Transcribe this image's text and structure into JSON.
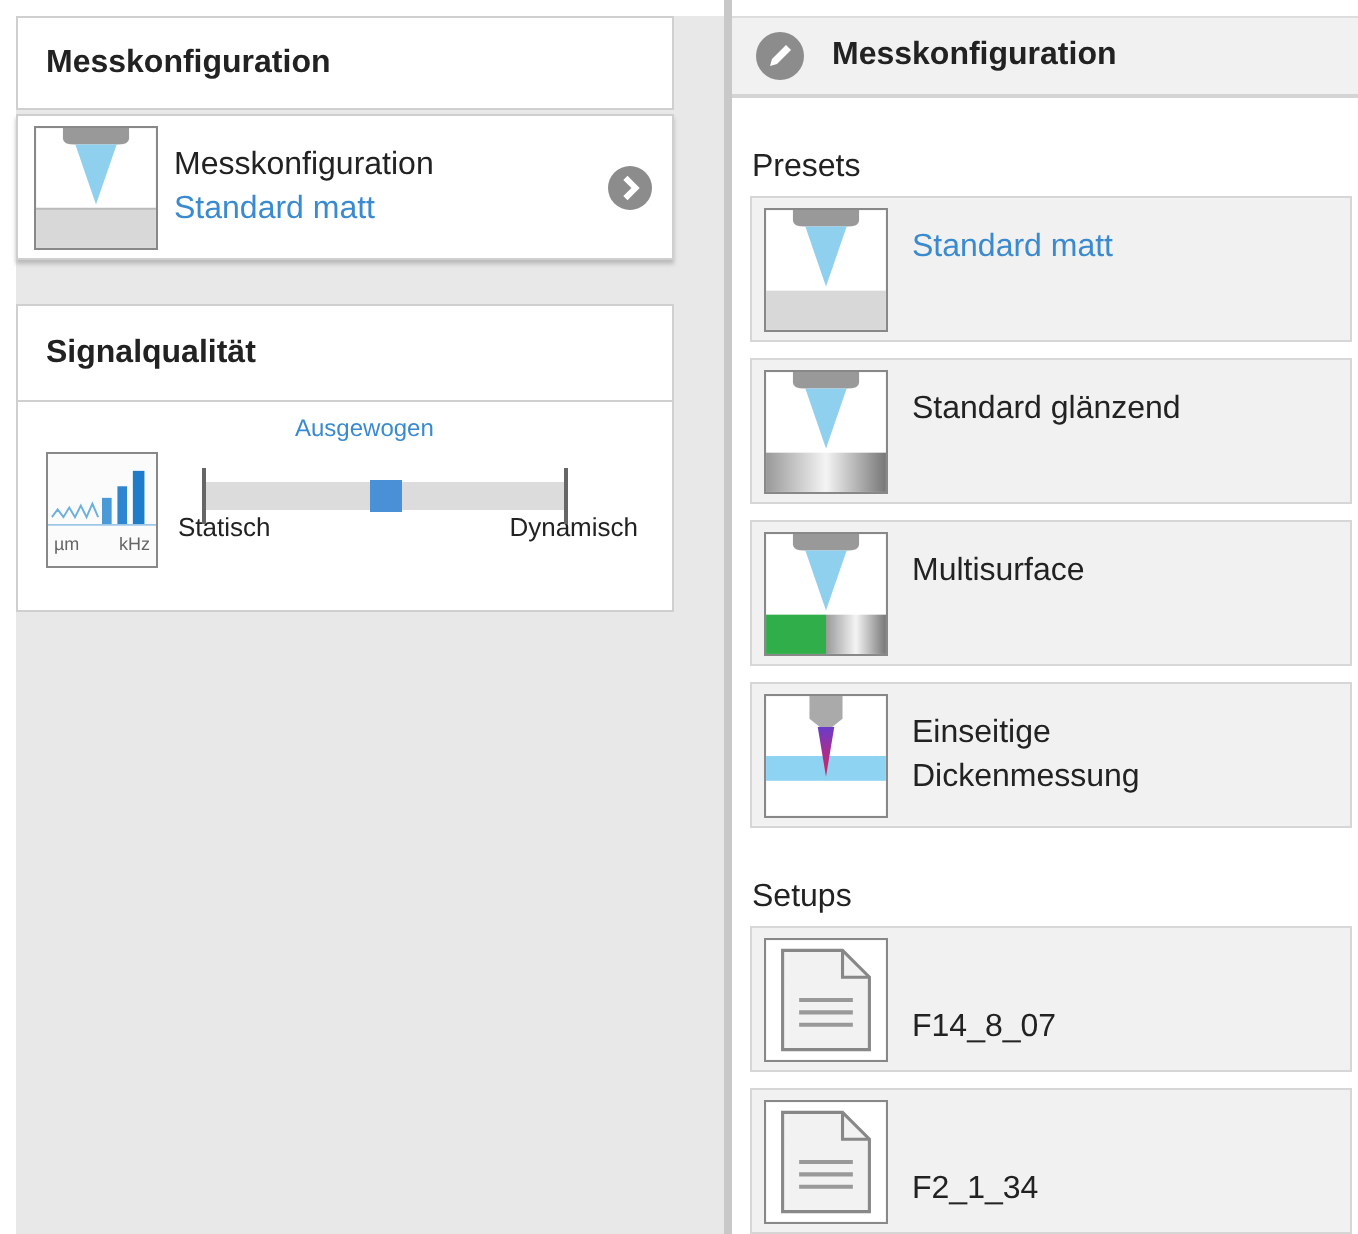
{
  "left_panel": {
    "header": "Messkonfiguration",
    "config_card": {
      "label": "Messkonfiguration",
      "value": "Standard matt"
    },
    "signal_card": {
      "title": "Signalqualität",
      "icon_labels": [
        "µm",
        "kHz"
      ],
      "slider": {
        "current": "Ausgewogen",
        "min_label": "Statisch",
        "max_label": "Dynamisch",
        "level": 0.5
      }
    }
  },
  "right_panel": {
    "title": "Messkonfiguration",
    "presets_label": "Presets",
    "presets": [
      {
        "label": "Standard matt",
        "kind": "matt",
        "selected": true
      },
      {
        "label": "Standard glänzend",
        "kind": "gloss",
        "selected": false
      },
      {
        "label": "Multisurface",
        "kind": "multi",
        "selected": false
      },
      {
        "label": "Einseitige Dickenmessung",
        "kind": "thickness",
        "selected": false
      }
    ],
    "setups_label": "Setups",
    "setups": [
      {
        "label": "F14_8_07"
      },
      {
        "label": "F2_1_34"
      }
    ]
  }
}
